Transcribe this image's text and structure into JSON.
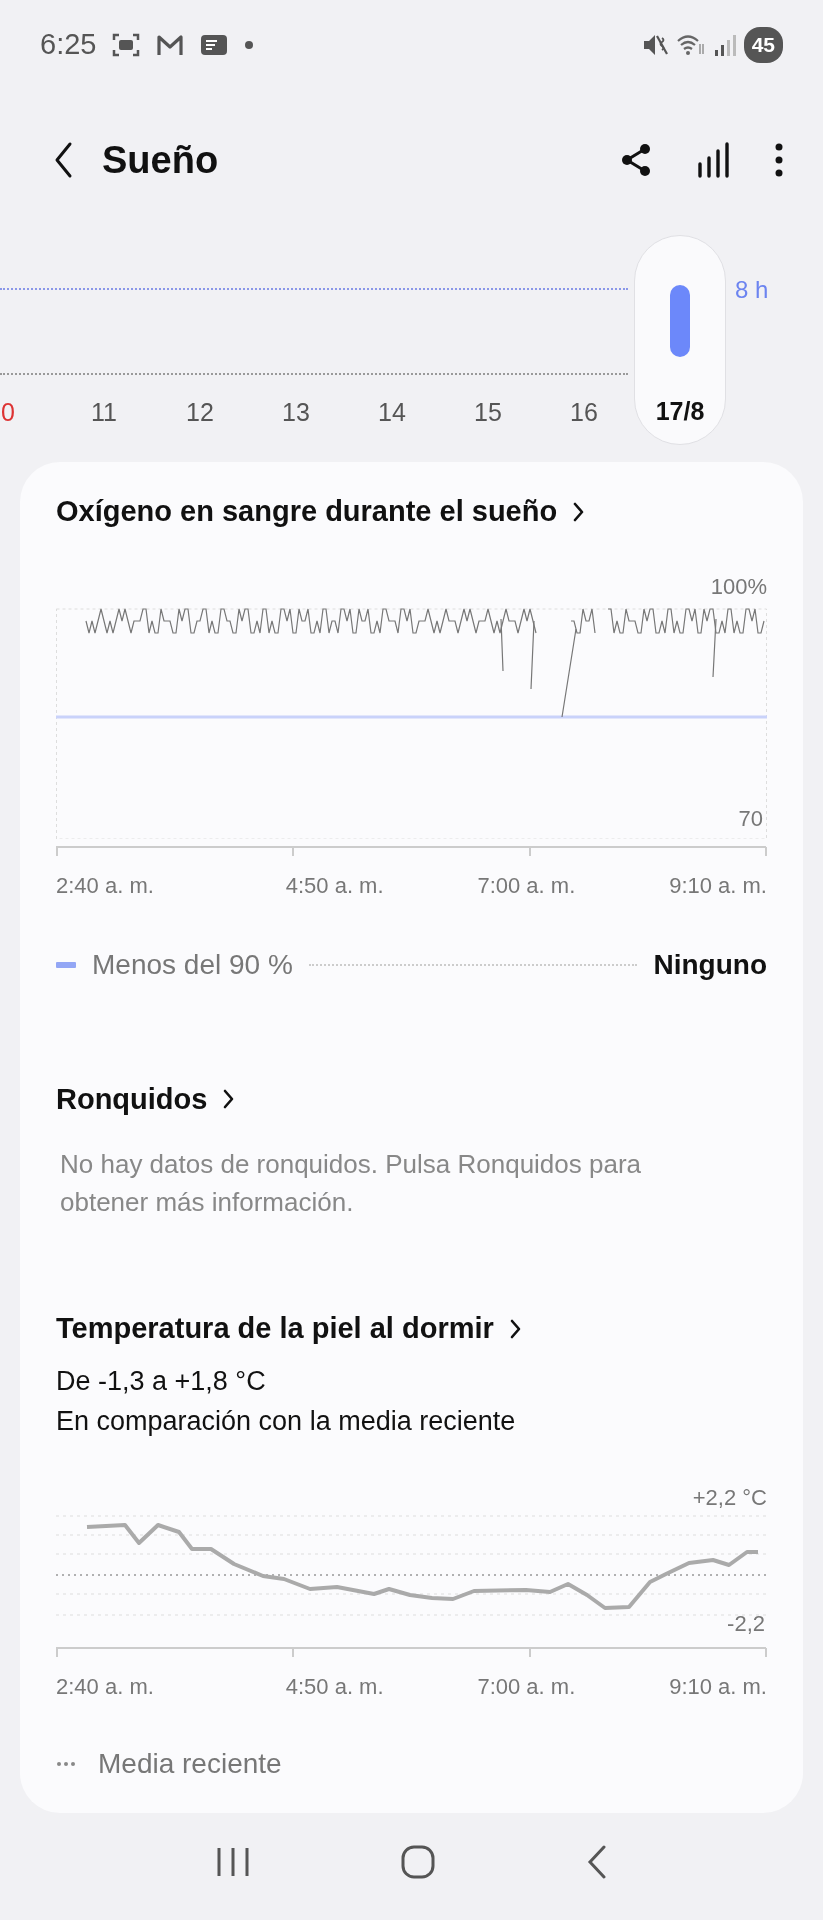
{
  "status_bar": {
    "time": "6:25",
    "battery": "45"
  },
  "header": {
    "title": "Sueño"
  },
  "week_chart": {
    "goal_label": "8 h",
    "days": [
      {
        "label": "0",
        "sunday": true,
        "selected": false
      },
      {
        "label": "11",
        "sunday": false,
        "selected": false
      },
      {
        "label": "12",
        "sunday": false,
        "selected": false
      },
      {
        "label": "13",
        "sunday": false,
        "selected": false
      },
      {
        "label": "14",
        "sunday": false,
        "selected": false
      },
      {
        "label": "15",
        "sunday": false,
        "selected": false
      },
      {
        "label": "16",
        "sunday": false,
        "selected": false
      },
      {
        "label": "17/8",
        "sunday": false,
        "selected": true
      }
    ]
  },
  "oxygen": {
    "title": "Oxígeno en sangre durante el sueño",
    "y_max": "100%",
    "y_min": "70",
    "x_labels": [
      "2:40 a. m.",
      "4:50 a. m.",
      "7:00 a. m.",
      "9:10 a. m."
    ],
    "legend": {
      "label": "Menos del 90 %",
      "value": "Ninguno"
    }
  },
  "snoring": {
    "title": "Ronquidos",
    "message": "No hay datos de ronquidos. Pulsa Ronquidos para obtener más información."
  },
  "skin_temperature": {
    "title": "Temperatura de la piel al dormir",
    "range": "De -1,3 a +1,8 °C",
    "subtitle": "En comparación con la media reciente",
    "y_max": "+2,2 °C",
    "y_min": "-2,2",
    "x_labels": [
      "2:40 a. m.",
      "4:50 a. m.",
      "7:00 a. m.",
      "9:10 a. m."
    ],
    "legend": {
      "label": "Media reciente"
    }
  }
}
